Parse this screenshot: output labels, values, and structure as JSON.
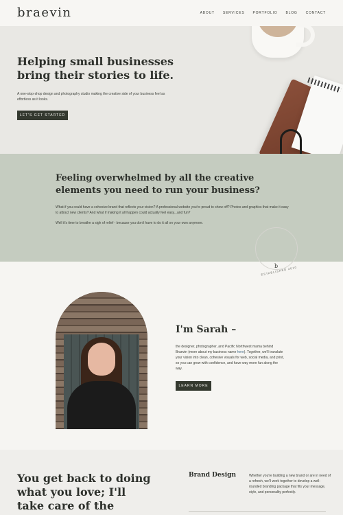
{
  "header": {
    "logo": "braevin",
    "nav": [
      "ABOUT",
      "SERVICES",
      "PORTFOLIO",
      "BLOG",
      "CONTACT"
    ]
  },
  "hero": {
    "title": "Helping small businesses bring their stories to life.",
    "text": "A one-stop-shop design and photography studio making the creative side of your business feel as effortless as it looks.",
    "button": "LET'S GET STARTED"
  },
  "overwhelm": {
    "title": "Feeling overwhelmed by all the creative elements you need to run your business?",
    "paragraph_1": "What if you could have a cohesive brand that reflects your vision? A professional website you're proud to show off? Photos and graphics that make it easy to attract new clients? And what if making it all happen could actually feel easy...and fun?",
    "paragraph_2": "Well it's time to breathe a sigh of relief - because you don't have to do it all on your own anymore."
  },
  "about": {
    "stamp_text": "ESTABLISHED 2010",
    "stamp_mark": "b",
    "title": "I'm Sarah –",
    "text_before_link": "the designer, photographer, and Pacific Northwest mama behind Braevin (more about my business name ",
    "link_text": "here",
    "text_after_link": "). Together, we'll translate your vision into clean, cohesive visuals for web, social media, and print, so you can grow with confidence, and have way more fun along the way.",
    "button": "LEARN MORE"
  },
  "bottom": {
    "title": "You get back to doing what you love; I'll take care of the creative",
    "service_title": "Brand Design",
    "service_text": "Whether you're building a new brand or are in need of a refresh, we'll work together to develop a well-rounded branding package that fits your message, style, and personality perfectly."
  },
  "colors": {
    "sage": "#c5ccc0",
    "button": "#34392f",
    "link": "#466f8c"
  }
}
